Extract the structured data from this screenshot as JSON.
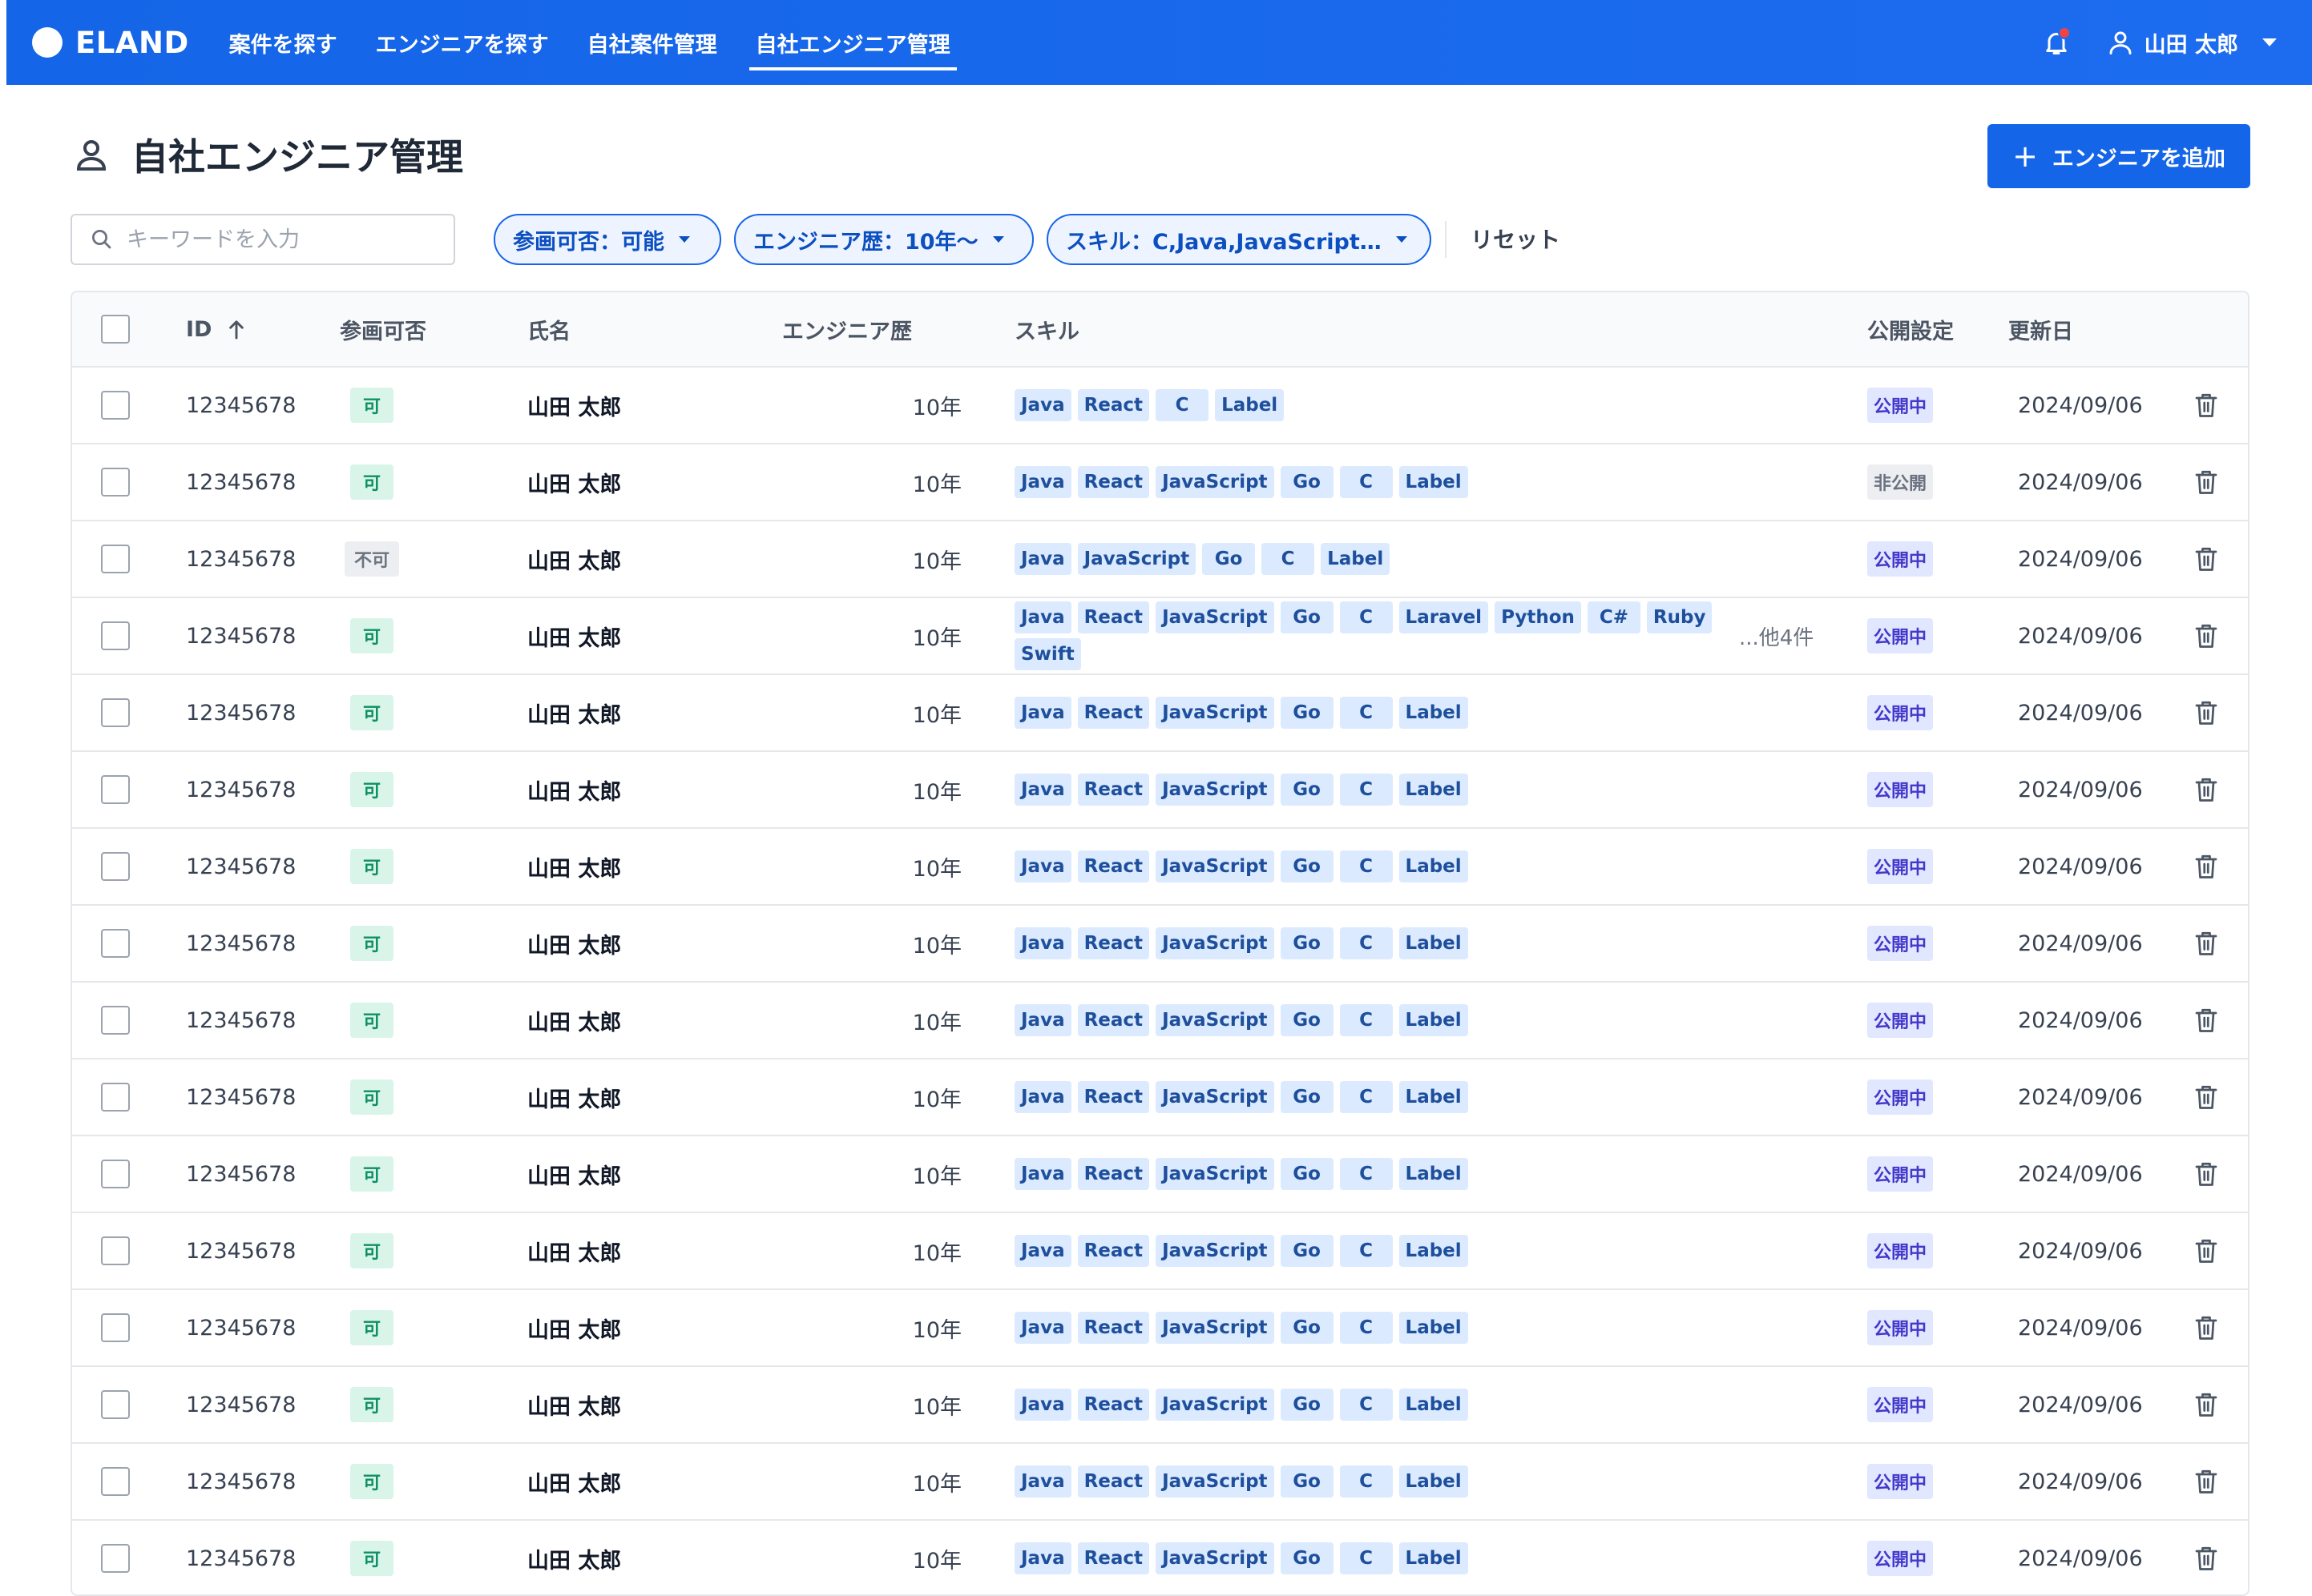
{
  "brand": {
    "name": "ELAND"
  },
  "nav": {
    "items": [
      {
        "label": "案件を探す"
      },
      {
        "label": "エンジニアを探す"
      },
      {
        "label": "自社案件管理"
      },
      {
        "label": "自社エンジニア管理"
      }
    ],
    "active_index": 3
  },
  "user": {
    "name": "山田 太郎",
    "has_notification": true
  },
  "page": {
    "title": "自社エンジニア管理",
    "add_button_label": "エンジニアを追加",
    "icons": {
      "title": "person-icon",
      "add": "plus-icon"
    }
  },
  "filters": {
    "search_placeholder": "キーワードを入力",
    "chips": [
      {
        "label": "参画可否：可能"
      },
      {
        "label": "エンジニア歴：10年〜"
      },
      {
        "label": "スキル：C,Java,JavaScript…"
      }
    ],
    "reset_label": "リセット"
  },
  "table": {
    "columns": {
      "id": "ID",
      "availability": "参画可否",
      "name": "氏名",
      "experience": "エンジニア歴",
      "skills": "スキル",
      "visibility": "公開設定",
      "updated": "更新日"
    },
    "sort": {
      "column": "id",
      "direction": "asc"
    },
    "rows": [
      {
        "id": "12345678",
        "availability": "可",
        "available": true,
        "name": "山田 太郎",
        "experience": "10年",
        "skills": [
          "Java",
          "React",
          "C",
          "Label"
        ],
        "more": "",
        "visibility": "公開中",
        "public": true,
        "updated": "2024/09/06"
      },
      {
        "id": "12345678",
        "availability": "可",
        "available": true,
        "name": "山田 太郎",
        "experience": "10年",
        "skills": [
          "Java",
          "React",
          "JavaScript",
          "Go",
          "C",
          "Label"
        ],
        "more": "",
        "visibility": "非公開",
        "public": false,
        "updated": "2024/09/06"
      },
      {
        "id": "12345678",
        "availability": "不可",
        "available": false,
        "name": "山田 太郎",
        "experience": "10年",
        "skills": [
          "Java",
          "JavaScript",
          "Go",
          "C",
          "Label"
        ],
        "more": "",
        "visibility": "公開中",
        "public": true,
        "updated": "2024/09/06"
      },
      {
        "id": "12345678",
        "availability": "可",
        "available": true,
        "name": "山田 太郎",
        "experience": "10年",
        "skills": [
          "Java",
          "React",
          "JavaScript",
          "Go",
          "C",
          "Laravel",
          "Python",
          "C#",
          "Ruby",
          "Swift"
        ],
        "more": "...他4件",
        "visibility": "公開中",
        "public": true,
        "updated": "2024/09/06"
      },
      {
        "id": "12345678",
        "availability": "可",
        "available": true,
        "name": "山田 太郎",
        "experience": "10年",
        "skills": [
          "Java",
          "React",
          "JavaScript",
          "Go",
          "C",
          "Label"
        ],
        "more": "",
        "visibility": "公開中",
        "public": true,
        "updated": "2024/09/06"
      },
      {
        "id": "12345678",
        "availability": "可",
        "available": true,
        "name": "山田 太郎",
        "experience": "10年",
        "skills": [
          "Java",
          "React",
          "JavaScript",
          "Go",
          "C",
          "Label"
        ],
        "more": "",
        "visibility": "公開中",
        "public": true,
        "updated": "2024/09/06"
      },
      {
        "id": "12345678",
        "availability": "可",
        "available": true,
        "name": "山田 太郎",
        "experience": "10年",
        "skills": [
          "Java",
          "React",
          "JavaScript",
          "Go",
          "C",
          "Label"
        ],
        "more": "",
        "visibility": "公開中",
        "public": true,
        "updated": "2024/09/06"
      },
      {
        "id": "12345678",
        "availability": "可",
        "available": true,
        "name": "山田 太郎",
        "experience": "10年",
        "skills": [
          "Java",
          "React",
          "JavaScript",
          "Go",
          "C",
          "Label"
        ],
        "more": "",
        "visibility": "公開中",
        "public": true,
        "updated": "2024/09/06"
      },
      {
        "id": "12345678",
        "availability": "可",
        "available": true,
        "name": "山田 太郎",
        "experience": "10年",
        "skills": [
          "Java",
          "React",
          "JavaScript",
          "Go",
          "C",
          "Label"
        ],
        "more": "",
        "visibility": "公開中",
        "public": true,
        "updated": "2024/09/06"
      },
      {
        "id": "12345678",
        "availability": "可",
        "available": true,
        "name": "山田 太郎",
        "experience": "10年",
        "skills": [
          "Java",
          "React",
          "JavaScript",
          "Go",
          "C",
          "Label"
        ],
        "more": "",
        "visibility": "公開中",
        "public": true,
        "updated": "2024/09/06"
      },
      {
        "id": "12345678",
        "availability": "可",
        "available": true,
        "name": "山田 太郎",
        "experience": "10年",
        "skills": [
          "Java",
          "React",
          "JavaScript",
          "Go",
          "C",
          "Label"
        ],
        "more": "",
        "visibility": "公開中",
        "public": true,
        "updated": "2024/09/06"
      },
      {
        "id": "12345678",
        "availability": "可",
        "available": true,
        "name": "山田 太郎",
        "experience": "10年",
        "skills": [
          "Java",
          "React",
          "JavaScript",
          "Go",
          "C",
          "Label"
        ],
        "more": "",
        "visibility": "公開中",
        "public": true,
        "updated": "2024/09/06"
      },
      {
        "id": "12345678",
        "availability": "可",
        "available": true,
        "name": "山田 太郎",
        "experience": "10年",
        "skills": [
          "Java",
          "React",
          "JavaScript",
          "Go",
          "C",
          "Label"
        ],
        "more": "",
        "visibility": "公開中",
        "public": true,
        "updated": "2024/09/06"
      },
      {
        "id": "12345678",
        "availability": "可",
        "available": true,
        "name": "山田 太郎",
        "experience": "10年",
        "skills": [
          "Java",
          "React",
          "JavaScript",
          "Go",
          "C",
          "Label"
        ],
        "more": "",
        "visibility": "公開中",
        "public": true,
        "updated": "2024/09/06"
      },
      {
        "id": "12345678",
        "availability": "可",
        "available": true,
        "name": "山田 太郎",
        "experience": "10年",
        "skills": [
          "Java",
          "React",
          "JavaScript",
          "Go",
          "C",
          "Label"
        ],
        "more": "",
        "visibility": "公開中",
        "public": true,
        "updated": "2024/09/06"
      },
      {
        "id": "12345678",
        "availability": "可",
        "available": true,
        "name": "山田 太郎",
        "experience": "10年",
        "skills": [
          "Java",
          "React",
          "JavaScript",
          "Go",
          "C",
          "Label"
        ],
        "more": "",
        "visibility": "公開中",
        "public": true,
        "updated": "2024/09/06"
      }
    ]
  },
  "colors": {
    "primary": "#1565e8",
    "available_bg": "#d9f5ea",
    "available_text": "#0e8f65",
    "skill_bg": "#dbeafe",
    "public_bg": "#e0e7ff",
    "notification": "#ef4444"
  }
}
